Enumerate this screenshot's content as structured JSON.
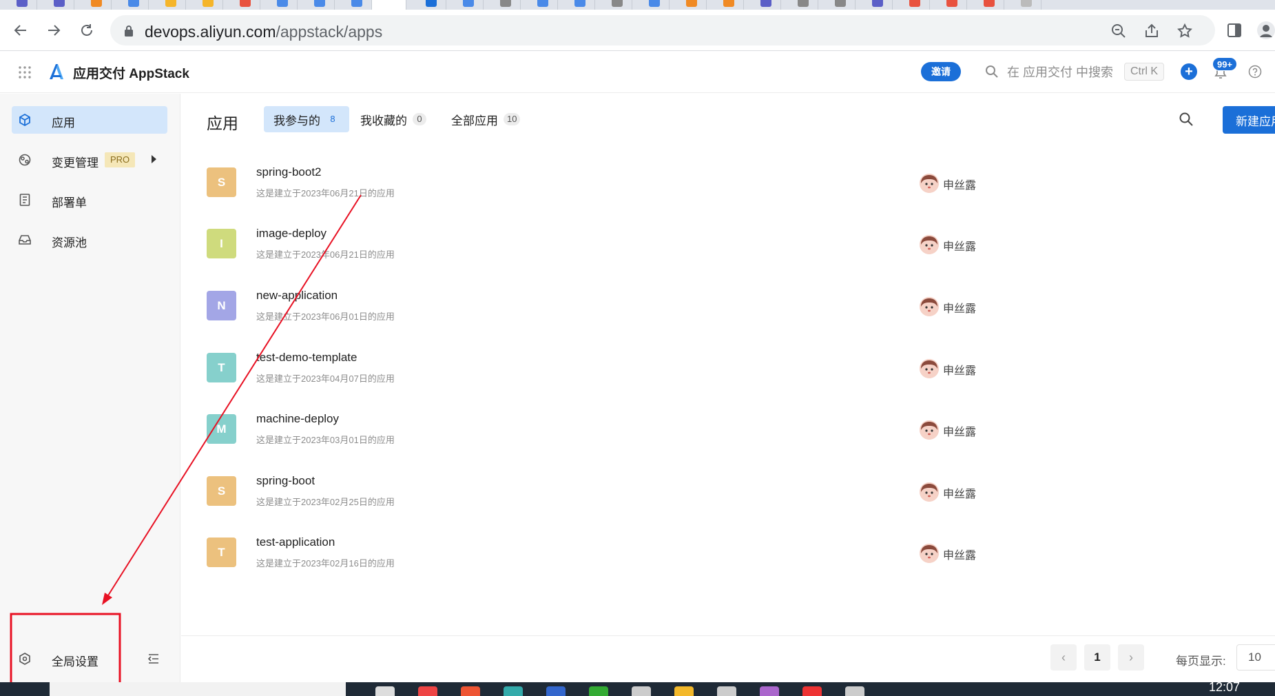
{
  "browser": {
    "url_host": "devops.aliyun.com",
    "url_path": "/appstack/apps"
  },
  "header": {
    "product_title": "应用交付 AppStack",
    "invite_label": "邀请",
    "search_placeholder": "在 应用交付 中搜索",
    "shortcut": "Ctrl K",
    "notification_badge": "99+"
  },
  "sidebar": {
    "items": [
      {
        "label": "应用",
        "icon": "cube-icon",
        "active": true
      },
      {
        "label": "变更管理",
        "icon": "change-icon",
        "badge": "PRO",
        "has_submenu": true
      },
      {
        "label": "部署单",
        "icon": "document-icon"
      },
      {
        "label": "资源池",
        "icon": "inbox-icon"
      }
    ],
    "settings_label": "全局设置"
  },
  "main": {
    "title": "应用",
    "tabs": [
      {
        "label": "我参与的",
        "count": "8",
        "active": true
      },
      {
        "label": "我收藏的",
        "count": "0"
      },
      {
        "label": "全部应用",
        "count": "10"
      }
    ],
    "new_app_label": "新建应用",
    "apps": [
      {
        "initial": "S",
        "name": "spring-boot2",
        "desc": "这是建立于2023年06月21日的应用",
        "color": "#ecc17e",
        "owner": "申丝露"
      },
      {
        "initial": "I",
        "name": "image-deploy",
        "desc": "这是建立于2023年06月21日的应用",
        "color": "#cfdb7d",
        "owner": "申丝露"
      },
      {
        "initial": "N",
        "name": "new-application",
        "desc": "这是建立于2023年06月01日的应用",
        "color": "#a3a6e6",
        "owner": "申丝露"
      },
      {
        "initial": "T",
        "name": "test-demo-template",
        "desc": "这是建立于2023年04月07日的应用",
        "color": "#86d0cc",
        "owner": "申丝露"
      },
      {
        "initial": "M",
        "name": "machine-deploy",
        "desc": "这是建立于2023年03月01日的应用",
        "color": "#86d0cc",
        "owner": "申丝露"
      },
      {
        "initial": "S",
        "name": "spring-boot",
        "desc": "这是建立于2023年02月25日的应用",
        "color": "#ecc17e",
        "owner": "申丝露"
      },
      {
        "initial": "T",
        "name": "test-application",
        "desc": "这是建立于2023年02月16日的应用",
        "color": "#ecc17e",
        "owner": "申丝露"
      }
    ],
    "pagination": {
      "current_page": "1",
      "page_size_label": "每页显示:",
      "page_size": "10"
    }
  },
  "taskbar": {
    "clock": "12:07"
  },
  "colors": {
    "accent": "#1b6fd8",
    "annotation": "#e81123"
  }
}
